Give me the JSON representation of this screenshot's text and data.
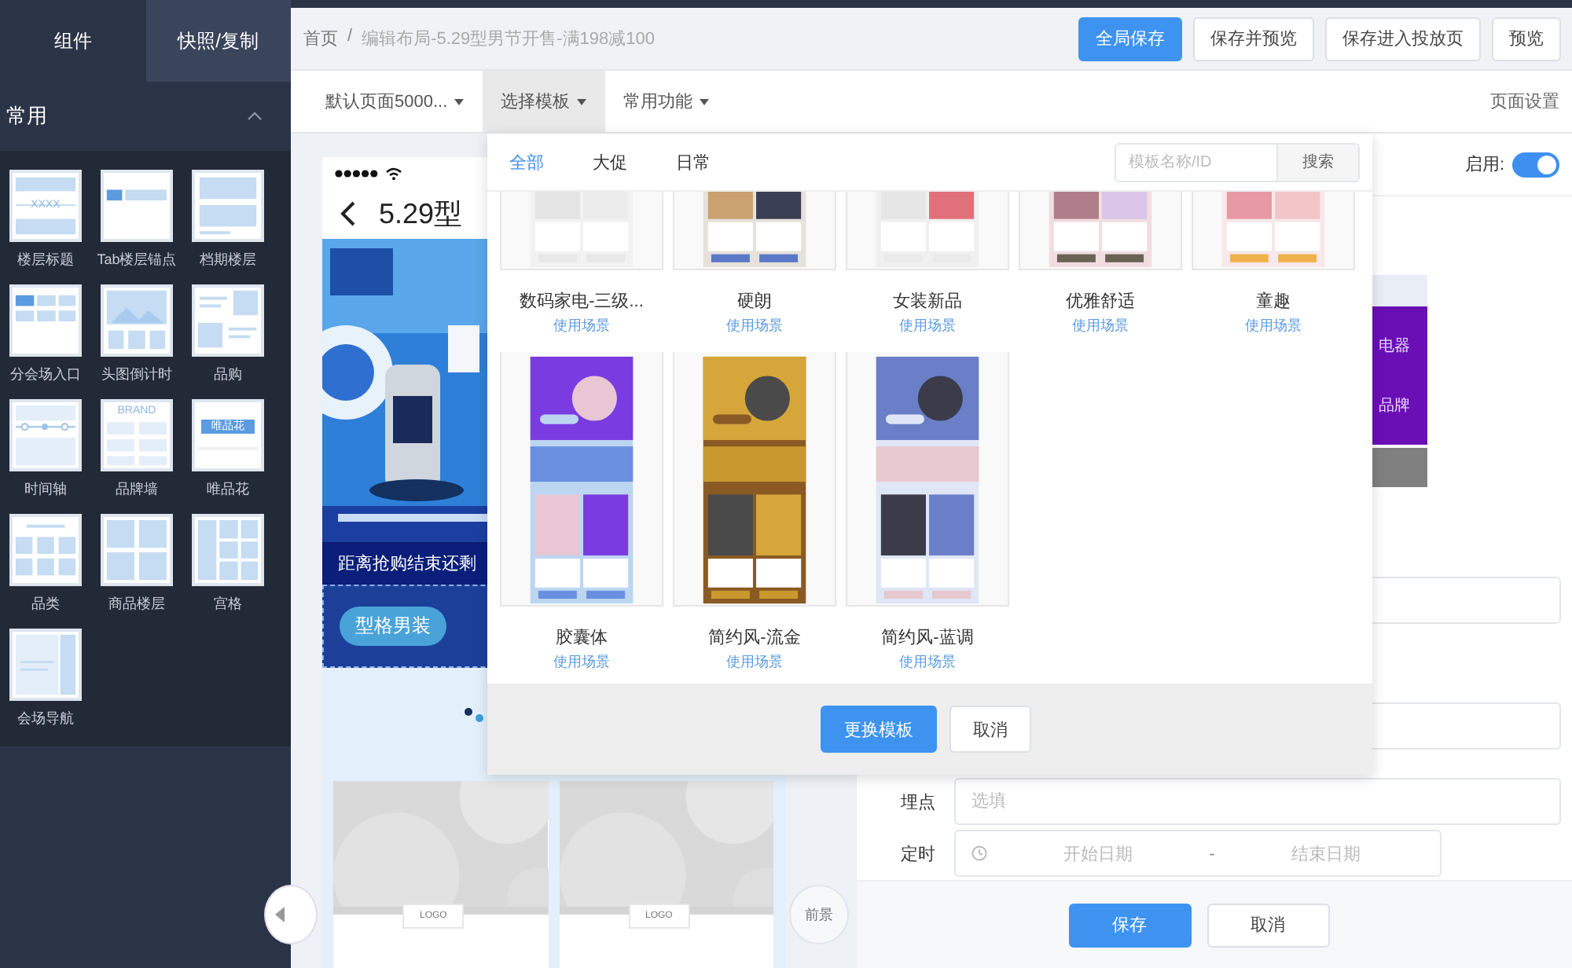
{
  "sidebar": {
    "tabs": [
      {
        "label": "组件",
        "selected": true
      },
      {
        "label": "快照/复制",
        "selected": false
      }
    ],
    "section": {
      "title": "常用",
      "expanded": true
    },
    "components": [
      {
        "label": "楼层标题",
        "kind": "title",
        "icon_text": "XXXX"
      },
      {
        "label": "Tab楼层锚点",
        "kind": "tabs"
      },
      {
        "label": "档期楼层",
        "kind": "schedule"
      },
      {
        "label": "分会场入口",
        "kind": "entry"
      },
      {
        "label": "头图倒计时",
        "kind": "countdown"
      },
      {
        "label": "品购",
        "kind": "brand_buy"
      },
      {
        "label": "时间轴",
        "kind": "timeline"
      },
      {
        "label": "品牌墙",
        "kind": "brand_wall",
        "icon_text": "BRAND"
      },
      {
        "label": "唯品花",
        "kind": "button_tile",
        "icon_text": "唯品花"
      },
      {
        "label": "品类",
        "kind": "category"
      },
      {
        "label": "商品楼层",
        "kind": "goods"
      },
      {
        "label": "宫格",
        "kind": "grid"
      },
      {
        "label": "会场导航",
        "kind": "nav"
      }
    ]
  },
  "breadcrumb": {
    "separator": "/",
    "items": [
      "首页",
      "编辑布局-5.29型男节开售-满198减100"
    ]
  },
  "header_buttons": [
    {
      "label": "全局保存",
      "primary": true
    },
    {
      "label": "保存并预览",
      "primary": false
    },
    {
      "label": "保存进入投放页",
      "primary": false
    },
    {
      "label": "预览",
      "primary": false
    }
  ],
  "toolbar": {
    "menus": [
      {
        "label": "默认页面5000...",
        "selected": false
      },
      {
        "label": "选择模板",
        "selected": true
      },
      {
        "label": "常用功能",
        "selected": false
      }
    ],
    "page_settings": "页面设置"
  },
  "phone": {
    "title": "5.29型",
    "countdown": "距离抢购结束还剩",
    "tabs": [
      {
        "label": "型格男装",
        "selected": true
      }
    ],
    "logos": [
      "LOGO",
      "LOGO"
    ]
  },
  "template_picker": {
    "tabs": [
      {
        "label": "全部",
        "selected": true
      },
      {
        "label": "大促",
        "selected": false
      },
      {
        "label": "日常",
        "selected": false
      }
    ],
    "search": {
      "placeholder": "模板名称/ID",
      "button": "搜索"
    },
    "rows": [
      [
        {
          "name": "数码家电-三级...",
          "link": "使用场景"
        },
        {
          "name": "硬朗",
          "link": "使用场景"
        },
        {
          "name": "女装新品",
          "link": "使用场景"
        },
        {
          "name": "优雅舒适",
          "link": "使用场景"
        },
        {
          "name": "童趣",
          "link": "使用场景"
        }
      ],
      [
        {
          "name": "胶囊体",
          "link": "使用场景"
        },
        {
          "name": "简约风-流金",
          "link": "使用场景"
        },
        {
          "name": "简约风-蓝调",
          "link": "使用场景"
        }
      ]
    ],
    "buttons": [
      {
        "label": "更换模板",
        "primary": true
      },
      {
        "label": "取消",
        "primary": false
      }
    ]
  },
  "settings": {
    "enable": {
      "label": "启用:",
      "on": true
    },
    "preview_labels": [
      "电器",
      "品牌"
    ],
    "fields": [
      {
        "kind": "text"
      },
      {
        "kind": "text"
      },
      {
        "kind": "text",
        "label": "埋点",
        "placeholder": "选填"
      },
      {
        "kind": "date_range",
        "label": "定时",
        "start": "开始日期",
        "separator": "-",
        "end": "结束日期"
      }
    ],
    "buttons": [
      {
        "label": "保存",
        "primary": true
      },
      {
        "label": "取消",
        "primary": false
      }
    ]
  },
  "foreground_button": "前景"
}
